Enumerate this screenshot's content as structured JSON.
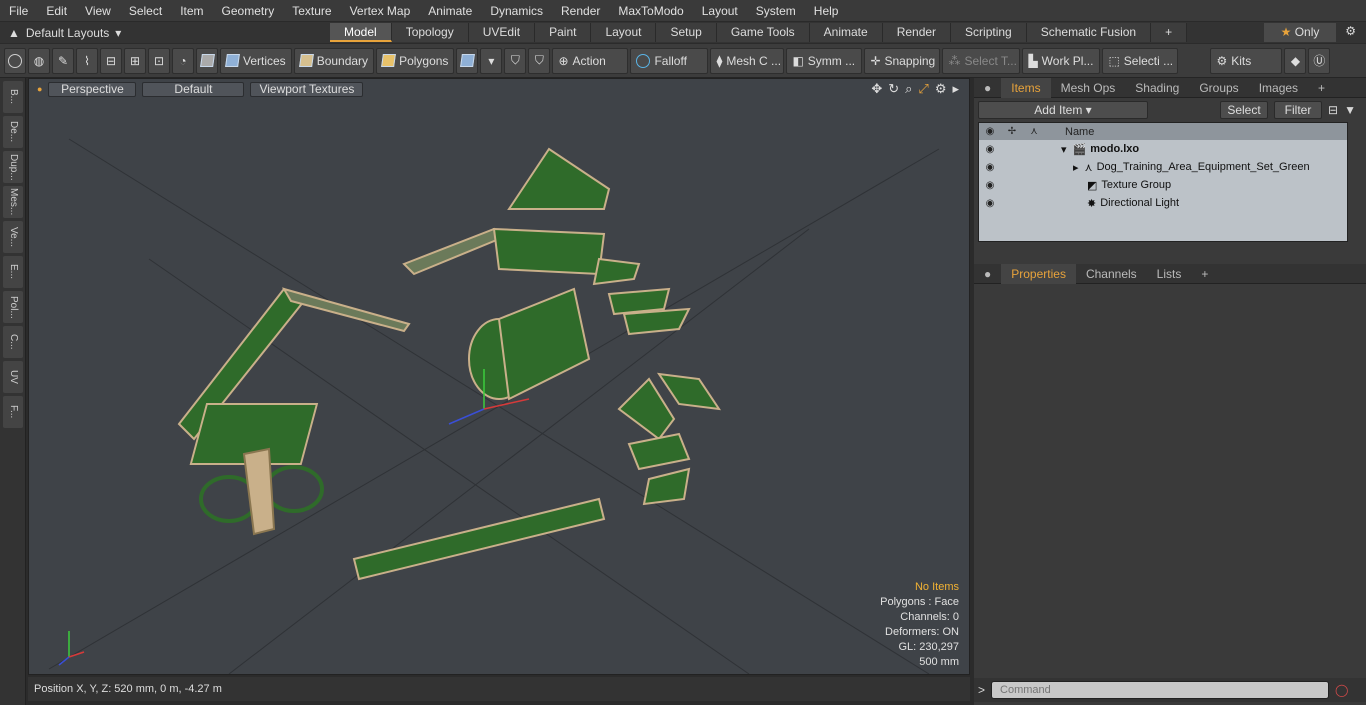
{
  "menu": [
    "File",
    "Edit",
    "View",
    "Select",
    "Item",
    "Geometry",
    "Texture",
    "Vertex Map",
    "Animate",
    "Dynamics",
    "Render",
    "MaxToModo",
    "Layout",
    "System",
    "Help"
  ],
  "layout_selector": "Default Layouts",
  "tabs": [
    "Model",
    "Topology",
    "UVEdit",
    "Paint",
    "Layout",
    "Setup",
    "Game Tools",
    "Animate",
    "Render",
    "Scripting",
    "Schematic Fusion"
  ],
  "only_label": "Only",
  "toolbar": {
    "vertices": "Vertices",
    "boundary": "Boundary",
    "polygons": "Polygons",
    "action": "Action",
    "falloff": "Falloff",
    "mesh": "Mesh C ...",
    "symm": "Symm ...",
    "snapping": "Snapping",
    "select_t": "Select T...",
    "work_pl": "Work Pl...",
    "selecti": "Selecti ...",
    "kits": "Kits"
  },
  "left_tabs": [
    "B...",
    "De...",
    "Dup...",
    "Mes...",
    "Ve...",
    "E...",
    "Pol...",
    "C...",
    "UV",
    "F..."
  ],
  "viewport": {
    "view_mode": "Perspective",
    "shading": "Default",
    "textures": "Viewport Textures",
    "stats": {
      "no_items": "No Items",
      "polygons": "Polygons : Face",
      "channels": "Channels: 0",
      "deformers": "Deformers: ON",
      "gl": "GL: 230,297",
      "scale": "500 mm"
    }
  },
  "status": "Position X, Y, Z:   520 mm, 0 m, -4.27 m",
  "panel_tabs": [
    "Items",
    "Mesh Ops",
    "Shading",
    "Groups",
    "Images"
  ],
  "items_bar": {
    "add_item": "Add Item",
    "select": "Select",
    "filter": "Filter"
  },
  "tree": {
    "name_header": "Name",
    "rows": [
      "modo.lxo",
      "Dog_Training_Area_Equipment_Set_Green",
      "Texture Group",
      "Directional Light"
    ]
  },
  "props_tabs": [
    "Properties",
    "Channels",
    "Lists"
  ],
  "command_placeholder": "Command",
  "colors": {
    "accent": "#e8a33b",
    "equipment": "#2f6b2a",
    "frame": "#c9b08a"
  }
}
